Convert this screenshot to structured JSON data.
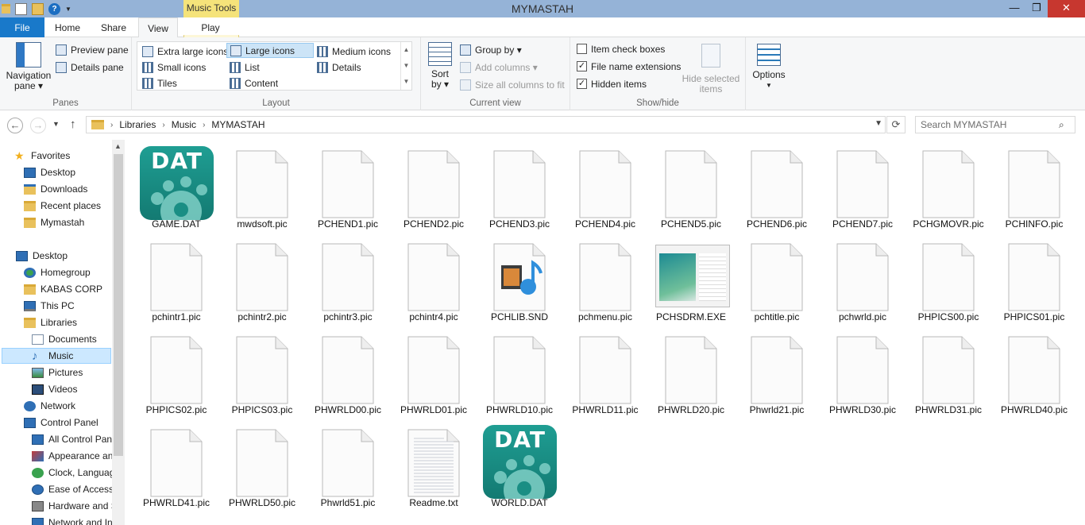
{
  "window": {
    "title": "MYMASTAH",
    "contextual_tab": "Music Tools",
    "controls": {
      "minimize": "—",
      "maximize": "❐",
      "close": "✕"
    }
  },
  "tabs": {
    "file": "File",
    "home": "Home",
    "share": "Share",
    "view": "View",
    "play": "Play"
  },
  "ribbon": {
    "panes": {
      "label": "Panes",
      "navigation_pane": "Navigation",
      "navigation_pane_2": "pane ▾",
      "preview_pane": "Preview pane",
      "details_pane": "Details pane"
    },
    "layout": {
      "label": "Layout",
      "items": [
        "Extra large icons",
        "Large icons",
        "Medium icons",
        "Small icons",
        "List",
        "Details",
        "Tiles",
        "Content"
      ],
      "selected": "Large icons"
    },
    "current_view": {
      "label": "Current view",
      "sort_by": "Sort",
      "sort_by_2": "by ▾",
      "group_by": "Group by ▾",
      "add_columns": "Add columns ▾",
      "size_columns": "Size all columns to fit"
    },
    "show_hide": {
      "label": "Show/hide",
      "item_check_boxes": "Item check boxes",
      "file_name_extensions": "File name extensions",
      "hidden_items": "Hidden items",
      "hide_selected": "Hide selected",
      "hide_selected_2": "items",
      "item_check_boxes_checked": false,
      "file_name_extensions_checked": true,
      "hidden_items_checked": true
    },
    "options": {
      "label": "Options"
    }
  },
  "address": {
    "crumbs": [
      "Libraries",
      "Music",
      "MYMASTAH"
    ],
    "search_placeholder": "Search MYMASTAH"
  },
  "nav": {
    "favorites": "Favorites",
    "favorites_items": [
      "Desktop",
      "Downloads",
      "Recent places",
      "Mymastah"
    ],
    "desktop": "Desktop",
    "desktop_items": [
      "Homegroup",
      "KABAS CORP",
      "This PC",
      "Libraries"
    ],
    "libraries_items": [
      "Documents",
      "Music",
      "Pictures",
      "Videos"
    ],
    "network": "Network",
    "control_panel": "Control Panel",
    "control_panel_items": [
      "All Control Pan",
      "Appearance an",
      "Clock, Languag",
      "Ease of Access",
      "Hardware and S",
      "Network and In"
    ]
  },
  "files": [
    {
      "name": "GAME.DAT",
      "type": "dat"
    },
    {
      "name": "mwdsoft.pic",
      "type": "doc"
    },
    {
      "name": "PCHEND1.pic",
      "type": "doc"
    },
    {
      "name": "PCHEND2.pic",
      "type": "doc"
    },
    {
      "name": "PCHEND3.pic",
      "type": "doc"
    },
    {
      "name": "PCHEND4.pic",
      "type": "doc"
    },
    {
      "name": "PCHEND5.pic",
      "type": "doc"
    },
    {
      "name": "PCHEND6.pic",
      "type": "doc"
    },
    {
      "name": "PCHEND7.pic",
      "type": "doc"
    },
    {
      "name": "PCHGMOVR.pic",
      "type": "doc"
    },
    {
      "name": "PCHINFO.pic",
      "type": "doc"
    },
    {
      "name": "pchintr1.pic",
      "type": "doc"
    },
    {
      "name": "pchintr2.pic",
      "type": "doc"
    },
    {
      "name": "pchintr3.pic",
      "type": "doc"
    },
    {
      "name": "pchintr4.pic",
      "type": "doc"
    },
    {
      "name": "PCHLIB.SND",
      "type": "snd"
    },
    {
      "name": "pchmenu.pic",
      "type": "doc"
    },
    {
      "name": "PCHSDRM.EXE",
      "type": "exe"
    },
    {
      "name": "pchtitle.pic",
      "type": "doc"
    },
    {
      "name": "pchwrld.pic",
      "type": "doc"
    },
    {
      "name": "PHPICS00.pic",
      "type": "doc"
    },
    {
      "name": "PHPICS01.pic",
      "type": "doc"
    },
    {
      "name": "PHPICS02.pic",
      "type": "doc"
    },
    {
      "name": "PHPICS03.pic",
      "type": "doc"
    },
    {
      "name": "PHWRLD00.pic",
      "type": "doc"
    },
    {
      "name": "PHWRLD01.pic",
      "type": "doc"
    },
    {
      "name": "PHWRLD10.pic",
      "type": "doc"
    },
    {
      "name": "PHWRLD11.pic",
      "type": "doc"
    },
    {
      "name": "PHWRLD20.pic",
      "type": "doc"
    },
    {
      "name": "Phwrld21.pic",
      "type": "doc"
    },
    {
      "name": "PHWRLD30.pic",
      "type": "doc"
    },
    {
      "name": "PHWRLD31.pic",
      "type": "doc"
    },
    {
      "name": "PHWRLD40.pic",
      "type": "doc"
    },
    {
      "name": "PHWRLD41.pic",
      "type": "doc"
    },
    {
      "name": "PHWRLD50.pic",
      "type": "doc"
    },
    {
      "name": "Phwrld51.pic",
      "type": "doc"
    },
    {
      "name": "Readme.txt",
      "type": "txt"
    },
    {
      "name": "WORLD.DAT",
      "type": "dat"
    }
  ],
  "dat_icon_label": "DAT",
  "colors": {
    "accent": "#1979ca",
    "title_bar": "#95b3d7",
    "contextual": "#f5e37a",
    "close": "#c7372f",
    "dat_teal": "#1a8e84",
    "selection": "#cce8ff"
  }
}
